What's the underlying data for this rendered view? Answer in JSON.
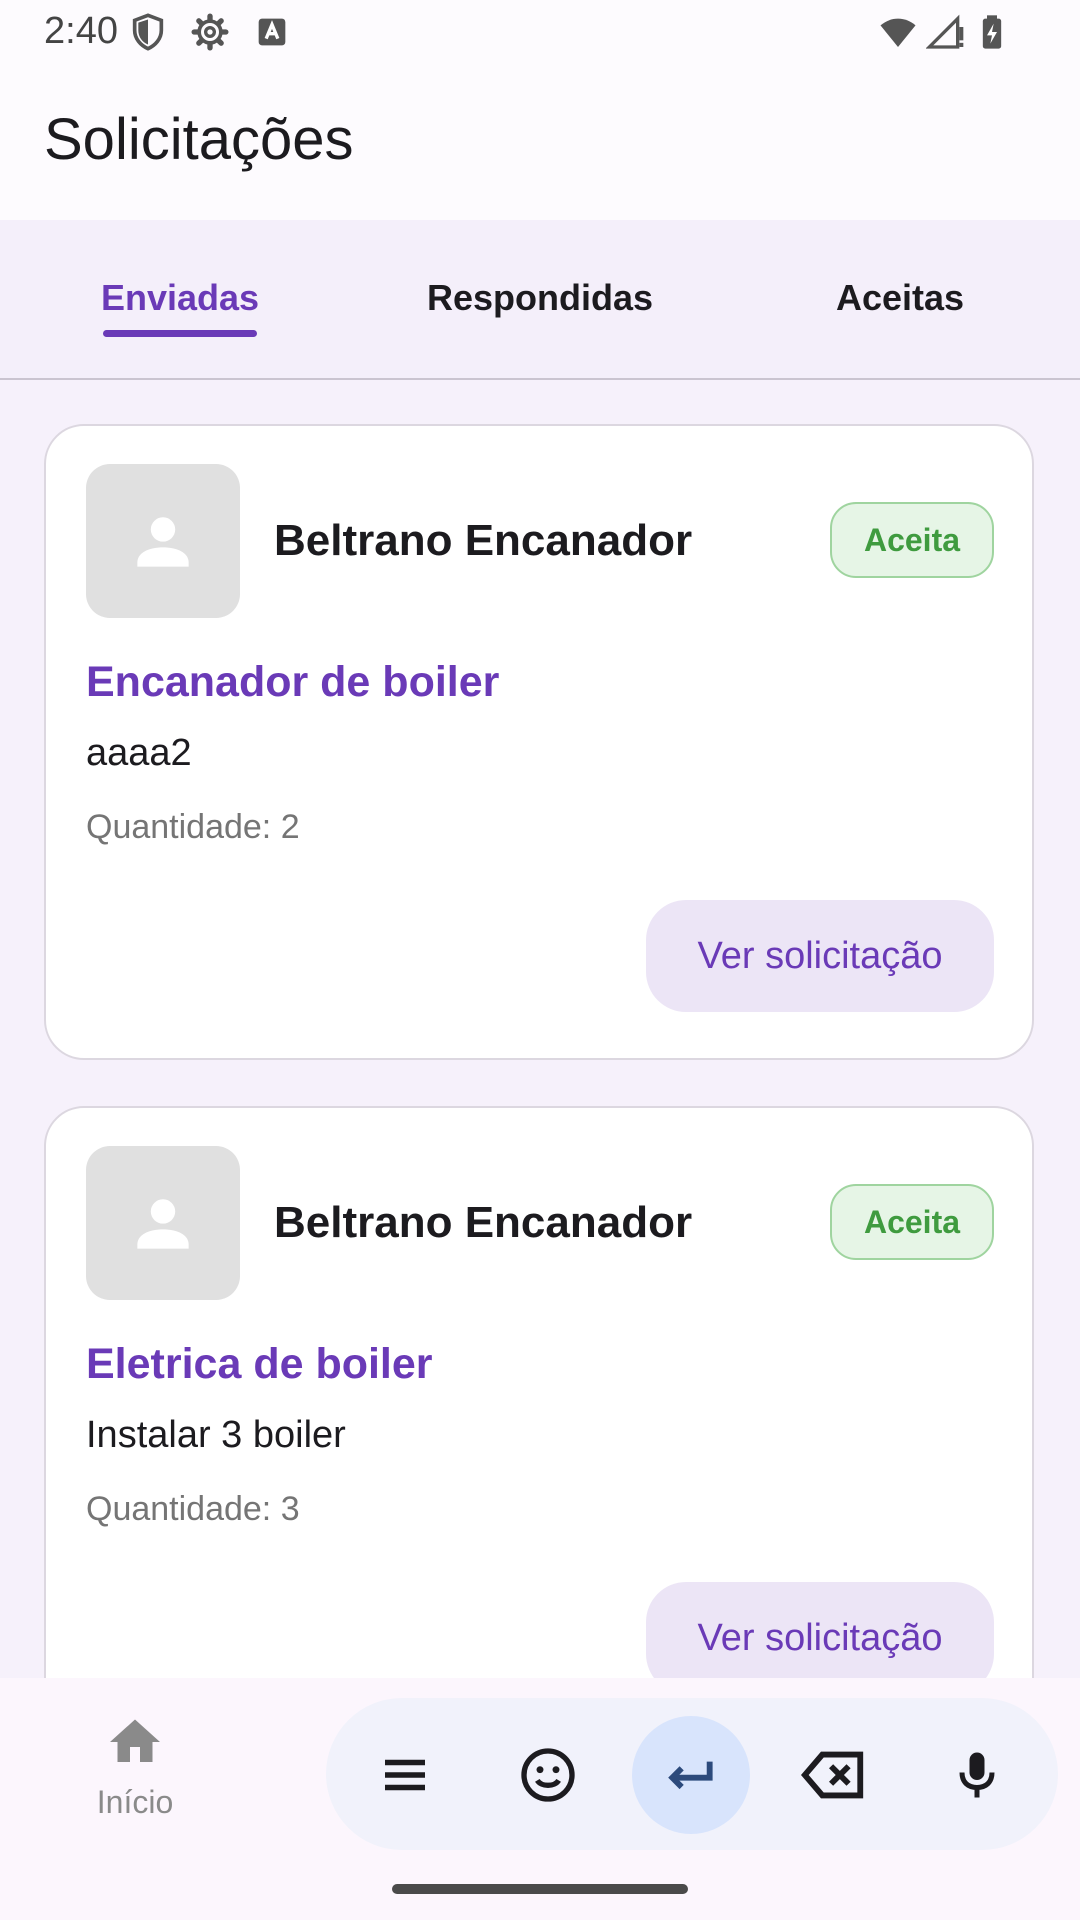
{
  "status_bar": {
    "time": "2:40"
  },
  "app_bar": {
    "title": "Solicitações"
  },
  "tabs": [
    {
      "label": "Enviadas",
      "active": true
    },
    {
      "label": "Respondidas",
      "active": false
    },
    {
      "label": "Aceitas",
      "active": false
    }
  ],
  "requests": [
    {
      "provider_name": "Beltrano Encanador",
      "status": "Aceita",
      "title": "Encanador de boiler",
      "description": "aaaa2",
      "quantity": "Quantidade: 2",
      "button_label": "Ver solicitação"
    },
    {
      "provider_name": "Beltrano Encanador",
      "status": "Aceita",
      "title": "Eletrica de boiler",
      "description": "Instalar 3 boiler",
      "quantity": "Quantidade: 3",
      "button_label": "Ver solicitação"
    }
  ],
  "bottom_nav": {
    "home_label": "Início"
  },
  "keyboard_toolbar": {
    "icons": [
      "menu-icon",
      "emoji-icon",
      "enter-icon",
      "backspace-icon",
      "microphone-icon"
    ]
  },
  "colors": {
    "accent": "#6a3ab7",
    "status_accepted": "#3f9b3f",
    "background": "#f6f1fb"
  }
}
